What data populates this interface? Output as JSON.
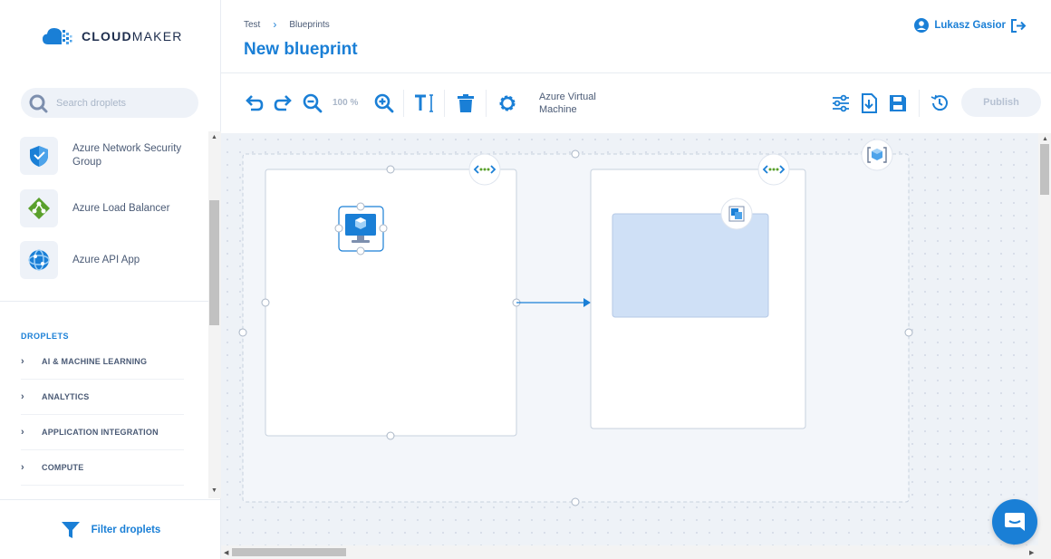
{
  "brand": {
    "name_bold": "CLOUD",
    "name_rest": "MAKER"
  },
  "search": {
    "placeholder": "Search droplets"
  },
  "droplets_list": [
    {
      "label": "Azure Network Security Group",
      "icon": "network-security-group-icon"
    },
    {
      "label": "Azure Load Balancer",
      "icon": "load-balancer-icon"
    },
    {
      "label": "Azure API App",
      "icon": "api-app-icon"
    }
  ],
  "droplets_section": {
    "heading": "DROPLETS",
    "categories": [
      "AI & MACHINE LEARNING",
      "ANALYTICS",
      "APPLICATION INTEGRATION",
      "COMPUTE"
    ]
  },
  "filter": {
    "label": "Filter droplets"
  },
  "breadcrumb": {
    "items": [
      "Test",
      "Blueprints"
    ]
  },
  "page": {
    "title": "New blueprint"
  },
  "user": {
    "name": "Lukasz Gasior"
  },
  "toolbar": {
    "zoom": "100 %",
    "selected_name": "Azure Virtual Machine",
    "publish_label": "Publish",
    "icons": [
      "undo-icon",
      "redo-icon",
      "zoom-out-icon",
      "zoom-in-icon",
      "text-icon",
      "trash-icon",
      "settings-icon",
      "sliders-icon",
      "download-icon",
      "save-icon",
      "history-icon"
    ]
  },
  "colors": {
    "accent": "#1a7fd6",
    "canvas": "#eef2f7",
    "node_fill": "#cfe0f6"
  }
}
